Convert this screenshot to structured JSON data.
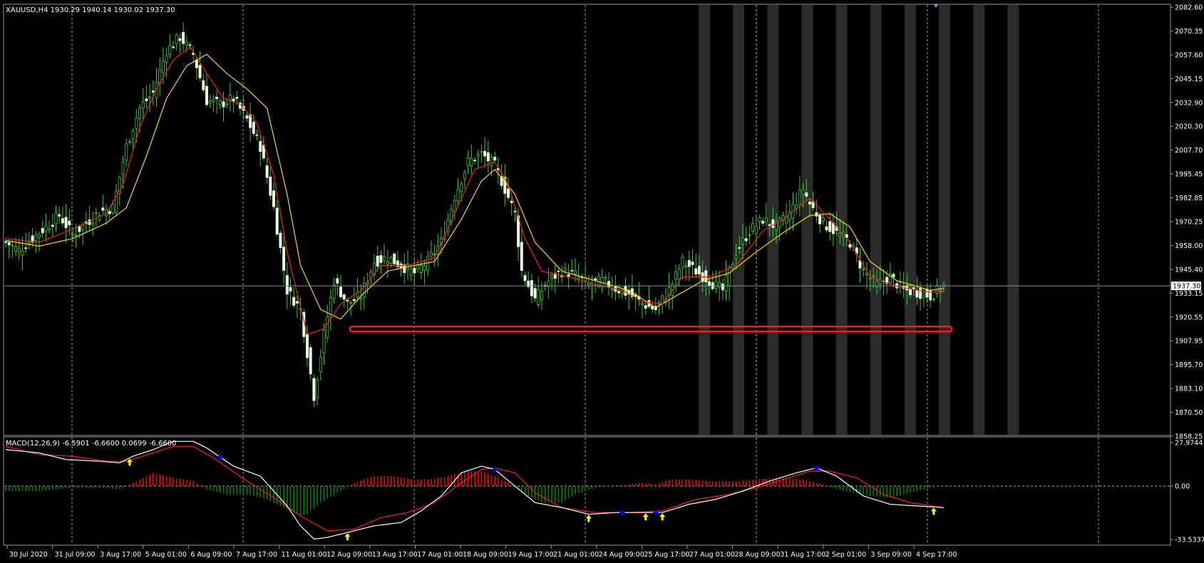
{
  "chart_data": [
    {
      "type": "candlestick",
      "title": "XAUUSD,H4  1930.29 1940.14 1930.02 1937.30",
      "symbol": "XAUUSD",
      "timeframe": "H4",
      "last_price": "1937.30",
      "ohlc_info": "1930.29 1940.14 1930.02 1937.30",
      "y_ticks": [
        "2082.60",
        "2070.35",
        "2057.60",
        "2045.15",
        "2032.90",
        "2020.30",
        "2007.70",
        "1995.45",
        "1982.85",
        "1970.25",
        "1958.00",
        "1945.40",
        "1933.15",
        "1920.55",
        "1907.95",
        "1895.70",
        "1883.10",
        "1870.50",
        "1858.25"
      ],
      "ylim": [
        1858.25,
        2082.6
      ],
      "x_labels": [
        "30 Jul 2020",
        "31 Jul 09:00",
        "3 Aug 17:00",
        "5 Aug 01:00",
        "6 Aug 09:00",
        "7 Aug 17:00",
        "11 Aug 01:00",
        "12 Aug 09:00",
        "13 Aug 17:00",
        "17 Aug 01:00",
        "18 Aug 09:00",
        "19 Aug 17:00",
        "21 Aug 01:00",
        "24 Aug 09:00",
        "25 Aug 17:00",
        "27 Aug 01:00",
        "28 Aug 09:00",
        "31 Aug 17:00",
        "2 Sep 01:00",
        "3 Sep 09:00",
        "4 Sep 17:00"
      ],
      "series_anchors": {
        "close": [
          [
            0,
            1960
          ],
          [
            4,
            1956
          ],
          [
            8,
            1962
          ],
          [
            12,
            1968
          ],
          [
            16,
            1974
          ],
          [
            20,
            1964
          ],
          [
            24,
            1970
          ],
          [
            28,
            1976
          ],
          [
            32,
            1978
          ],
          [
            36,
            2010
          ],
          [
            40,
            2030
          ],
          [
            44,
            2038
          ],
          [
            48,
            2060
          ],
          [
            52,
            2067
          ],
          [
            56,
            2058
          ],
          [
            60,
            2034
          ],
          [
            64,
            2032
          ],
          [
            68,
            2035
          ],
          [
            72,
            2024
          ],
          [
            76,
            2010
          ],
          [
            80,
            1978
          ],
          [
            84,
            1935
          ],
          [
            88,
            1925
          ],
          [
            92,
            1880
          ],
          [
            95,
            1912
          ],
          [
            98,
            1940
          ],
          [
            102,
            1928
          ],
          [
            106,
            1932
          ],
          [
            110,
            1950
          ],
          [
            114,
            1952
          ],
          [
            118,
            1948
          ],
          [
            122,
            1944
          ],
          [
            126,
            1950
          ],
          [
            130,
            1960
          ],
          [
            134,
            1984
          ],
          [
            138,
            2002
          ],
          [
            142,
            2006
          ],
          [
            146,
            2000
          ],
          [
            148,
            1992
          ],
          [
            152,
            1975
          ],
          [
            154,
            1945
          ],
          [
            158,
            1930
          ],
          [
            162,
            1940
          ],
          [
            166,
            1945
          ],
          [
            170,
            1943
          ],
          [
            174,
            1938
          ],
          [
            178,
            1940
          ],
          [
            182,
            1936
          ],
          [
            186,
            1933
          ],
          [
            190,
            1928
          ],
          [
            194,
            1925
          ],
          [
            198,
            1935
          ],
          [
            202,
            1950
          ],
          [
            206,
            1945
          ],
          [
            210,
            1940
          ],
          [
            214,
            1935
          ],
          [
            218,
            1955
          ],
          [
            222,
            1966
          ],
          [
            226,
            1972
          ],
          [
            230,
            1968
          ],
          [
            234,
            1975
          ],
          [
            238,
            1988
          ],
          [
            240,
            1980
          ],
          [
            244,
            1970
          ],
          [
            248,
            1965
          ],
          [
            252,
            1960
          ],
          [
            256,
            1945
          ],
          [
            260,
            1938
          ],
          [
            264,
            1942
          ],
          [
            268,
            1935
          ],
          [
            272,
            1934
          ],
          [
            276,
            1932
          ],
          [
            280,
            1937.3
          ]
        ],
        "ma_red": [
          [
            0,
            1962
          ],
          [
            10,
            1960
          ],
          [
            20,
            1967
          ],
          [
            30,
            1975
          ],
          [
            35,
            1990
          ],
          [
            40,
            2020
          ],
          [
            45,
            2040
          ],
          [
            50,
            2055
          ],
          [
            55,
            2062
          ],
          [
            60,
            2048
          ],
          [
            65,
            2035
          ],
          [
            70,
            2032
          ],
          [
            75,
            2022
          ],
          [
            80,
            1995
          ],
          [
            84,
            1955
          ],
          [
            90,
            1912
          ],
          [
            95,
            1915
          ],
          [
            100,
            1928
          ],
          [
            106,
            1935
          ],
          [
            112,
            1948
          ],
          [
            120,
            1948
          ],
          [
            128,
            1952
          ],
          [
            134,
            1975
          ],
          [
            140,
            1998
          ],
          [
            146,
            2002
          ],
          [
            150,
            1990
          ],
          [
            155,
            1962
          ],
          [
            160,
            1945
          ],
          [
            168,
            1942
          ],
          [
            176,
            1938
          ],
          [
            184,
            1935
          ],
          [
            190,
            1929
          ],
          [
            196,
            1928
          ],
          [
            202,
            1942
          ],
          [
            210,
            1942
          ],
          [
            218,
            1948
          ],
          [
            226,
            1966
          ],
          [
            232,
            1972
          ],
          [
            240,
            1983
          ],
          [
            246,
            1972
          ],
          [
            252,
            1960
          ],
          [
            258,
            1942
          ],
          [
            266,
            1937
          ],
          [
            276,
            1934
          ],
          [
            280,
            1935
          ]
        ],
        "ma_yellow": [
          [
            0,
            1961
          ],
          [
            10,
            1958
          ],
          [
            20,
            1962
          ],
          [
            30,
            1970
          ],
          [
            36,
            1978
          ],
          [
            42,
            2005
          ],
          [
            48,
            2035
          ],
          [
            54,
            2052
          ],
          [
            60,
            2058
          ],
          [
            66,
            2048
          ],
          [
            72,
            2040
          ],
          [
            78,
            2030
          ],
          [
            84,
            1985
          ],
          [
            88,
            1948
          ],
          [
            94,
            1925
          ],
          [
            100,
            1920
          ],
          [
            106,
            1932
          ],
          [
            114,
            1945
          ],
          [
            122,
            1948
          ],
          [
            128,
            1950
          ],
          [
            136,
            1972
          ],
          [
            142,
            1992
          ],
          [
            146,
            1998
          ],
          [
            152,
            1985
          ],
          [
            158,
            1960
          ],
          [
            166,
            1945
          ],
          [
            176,
            1940
          ],
          [
            186,
            1935
          ],
          [
            194,
            1926
          ],
          [
            200,
            1932
          ],
          [
            208,
            1940
          ],
          [
            216,
            1944
          ],
          [
            224,
            1955
          ],
          [
            232,
            1965
          ],
          [
            240,
            1974
          ],
          [
            246,
            1975
          ],
          [
            252,
            1968
          ],
          [
            258,
            1950
          ],
          [
            266,
            1940
          ],
          [
            276,
            1935
          ],
          [
            280,
            1936
          ]
        ]
      },
      "support_zone": {
        "y": 1915,
        "color": "#ff0000"
      },
      "shaded_bar_indices": [
        233,
        242,
        251,
        260,
        269,
        278,
        287,
        296,
        305,
        314
      ],
      "grid": true
    },
    {
      "type": "bar+line",
      "title": "MACD(12,26,9) -6.5901 -6.6600 0.0699 -6.6600",
      "y_ticks": [
        "27.9744",
        "0.00",
        "-33.5337"
      ],
      "ylim": [
        -33.5337,
        27.9744
      ],
      "series_anchors": {
        "histogram": [
          [
            0,
            -3
          ],
          [
            10,
            -3
          ],
          [
            20,
            -1
          ],
          [
            30,
            -1
          ],
          [
            34,
            -2
          ],
          [
            38,
            2
          ],
          [
            44,
            8
          ],
          [
            50,
            5
          ],
          [
            56,
            3
          ],
          [
            60,
            -2
          ],
          [
            66,
            -5
          ],
          [
            72,
            -5
          ],
          [
            78,
            -8
          ],
          [
            84,
            -14
          ],
          [
            88,
            -18
          ],
          [
            90,
            -17
          ],
          [
            94,
            -10
          ],
          [
            100,
            -3
          ],
          [
            104,
            2
          ],
          [
            110,
            6
          ],
          [
            116,
            6
          ],
          [
            122,
            4
          ],
          [
            126,
            4
          ],
          [
            132,
            6
          ],
          [
            138,
            9
          ],
          [
            142,
            9
          ],
          [
            146,
            6
          ],
          [
            150,
            2
          ],
          [
            154,
            -4
          ],
          [
            160,
            -10
          ],
          [
            166,
            -10
          ],
          [
            170,
            -5
          ],
          [
            176,
            -1
          ],
          [
            186,
            1
          ],
          [
            190,
            2
          ],
          [
            194,
            1
          ],
          [
            198,
            4
          ],
          [
            204,
            4
          ],
          [
            210,
            3
          ],
          [
            218,
            3
          ],
          [
            224,
            4
          ],
          [
            230,
            5
          ],
          [
            238,
            4
          ],
          [
            244,
            1
          ],
          [
            250,
            -3
          ],
          [
            258,
            -6
          ],
          [
            264,
            -7
          ],
          [
            270,
            -4
          ],
          [
            276,
            -1
          ],
          [
            280,
            0
          ]
        ],
        "macd_white": [
          [
            0,
            22
          ],
          [
            10,
            20
          ],
          [
            18,
            16
          ],
          [
            28,
            15
          ],
          [
            34,
            14
          ],
          [
            38,
            18
          ],
          [
            44,
            22
          ],
          [
            50,
            27
          ],
          [
            56,
            27
          ],
          [
            60,
            23
          ],
          [
            68,
            12
          ],
          [
            76,
            6
          ],
          [
            84,
            -12
          ],
          [
            88,
            -24
          ],
          [
            92,
            -32
          ],
          [
            96,
            -31
          ],
          [
            102,
            -28
          ],
          [
            110,
            -24
          ],
          [
            118,
            -22
          ],
          [
            124,
            -15
          ],
          [
            130,
            -6
          ],
          [
            136,
            8
          ],
          [
            142,
            12
          ],
          [
            146,
            10
          ],
          [
            152,
            0
          ],
          [
            158,
            -10
          ],
          [
            166,
            -13
          ],
          [
            174,
            -17
          ],
          [
            182,
            -16
          ],
          [
            190,
            -16
          ],
          [
            196,
            -16
          ],
          [
            204,
            -11
          ],
          [
            212,
            -8
          ],
          [
            220,
            -3
          ],
          [
            228,
            3
          ],
          [
            236,
            8
          ],
          [
            242,
            11
          ],
          [
            248,
            6
          ],
          [
            256,
            -6
          ],
          [
            264,
            -11
          ],
          [
            272,
            -12
          ],
          [
            280,
            -13
          ]
        ],
        "signal_red": [
          [
            0,
            24
          ],
          [
            10,
            19
          ],
          [
            20,
            18
          ],
          [
            30,
            15
          ],
          [
            36,
            15
          ],
          [
            44,
            20
          ],
          [
            50,
            24
          ],
          [
            56,
            24
          ],
          [
            62,
            17
          ],
          [
            72,
            3
          ],
          [
            80,
            -7
          ],
          [
            88,
            -18
          ],
          [
            96,
            -27
          ],
          [
            104,
            -26
          ],
          [
            112,
            -19
          ],
          [
            120,
            -16
          ],
          [
            128,
            -10
          ],
          [
            136,
            2
          ],
          [
            142,
            10
          ],
          [
            146,
            11
          ],
          [
            152,
            8
          ],
          [
            158,
            -4
          ],
          [
            166,
            -13
          ],
          [
            176,
            -16
          ],
          [
            186,
            -16
          ],
          [
            196,
            -15
          ],
          [
            206,
            -8
          ],
          [
            216,
            -5
          ],
          [
            224,
            -1
          ],
          [
            232,
            4
          ],
          [
            240,
            9
          ],
          [
            246,
            9
          ],
          [
            254,
            5
          ],
          [
            262,
            -5
          ],
          [
            270,
            -10
          ],
          [
            280,
            -13
          ]
        ]
      },
      "signal_markers": [
        {
          "bar": 37,
          "type": "buy"
        },
        {
          "bar": 64,
          "type": "sell"
        },
        {
          "bar": 102,
          "type": "buy"
        },
        {
          "bar": 146,
          "type": "sell"
        },
        {
          "bar": 174,
          "type": "buy"
        },
        {
          "bar": 184,
          "type": "sell"
        },
        {
          "bar": 191,
          "type": "buy"
        },
        {
          "bar": 194,
          "type": "sell"
        },
        {
          "bar": 196,
          "type": "buy"
        },
        {
          "bar": 242,
          "type": "sell"
        },
        {
          "bar": 277,
          "type": "buy"
        }
      ],
      "colors": {
        "hist_up": "#ff0000",
        "hist_down": "#008000",
        "macd": "#ffffff",
        "signal": "#ff0000",
        "buy_arrow": "#ffff00",
        "sell_marker": "#0000ff"
      }
    }
  ],
  "bar_count": 281
}
